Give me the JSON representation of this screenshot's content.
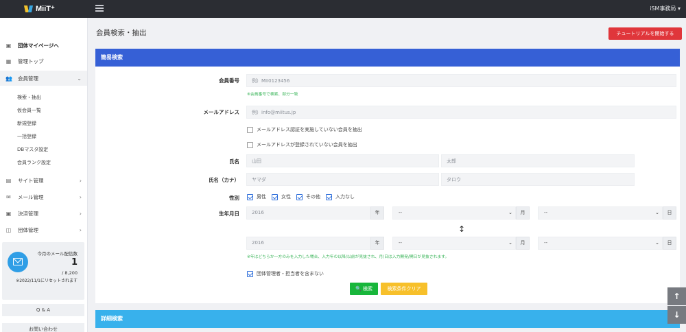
{
  "header": {
    "logo": "MiiT⁺",
    "user": "iSM事務局 ▾"
  },
  "sidebar": {
    "items": [
      {
        "label": "団体マイページへ",
        "icon": "building-icon"
      },
      {
        "label": "管理トップ",
        "icon": "dashboard-icon"
      },
      {
        "label": "会員管理",
        "icon": "users-icon"
      },
      {
        "label": "サイト管理",
        "icon": "site-icon"
      },
      {
        "label": "メール管理",
        "icon": "mail-icon"
      },
      {
        "label": "決済管理",
        "icon": "payment-icon"
      },
      {
        "label": "団体管理",
        "icon": "organization-icon"
      }
    ],
    "submenu": [
      "検索・抽出",
      "仮会員一覧",
      "新規登録",
      "一括登録",
      "DBマスタ設定",
      "会員ランク設定"
    ],
    "mail_card": {
      "title": "今月のメール配信数",
      "count": "1",
      "total": "/ 8,200",
      "reset": "※2022/11/1にリセットされます"
    },
    "qa": "Q & A",
    "contact": "お問い合わせ"
  },
  "page": {
    "title": "会員検索・抽出",
    "tutorial_button": "チュートリアルを開始する"
  },
  "simple_search": {
    "header": "簡易検索",
    "member_number": {
      "label": "会員番号",
      "placeholder": "例）MII0123456",
      "hint": "※会員番号で検索、部分一致"
    },
    "email": {
      "label": "メールアドレス",
      "placeholder": "例）info@miitus.jp"
    },
    "email_checks": [
      "メールアドレス認証を実施していない会員を抽出",
      "メールアドレスが登録されていない会員を抽出"
    ],
    "name": {
      "label": "氏名",
      "last": "山田",
      "first": "太郎"
    },
    "kana": {
      "label": "氏名（カナ）",
      "last": "ヤマダ",
      "first": "タロウ"
    },
    "gender": {
      "label": "性別",
      "options": [
        "男性",
        "女性",
        "その他",
        "入力なし"
      ]
    },
    "birthday": {
      "label": "生年月日",
      "year": "2016",
      "year_unit": "年",
      "month": "--",
      "month_unit": "月",
      "day": "--",
      "day_unit": "日",
      "hint": "※年はどちらか一方のみを入力した場合、入力年の以降/以前が見抜され、月/日は入力開発/開日が見抜されます。"
    },
    "exclude_admin": "団体管理者・担当者を含まない",
    "search_button": "🔍 検索",
    "clear_button": "検索条件クリア"
  },
  "detail_search": {
    "header": "詳細検索"
  },
  "scroll": {
    "up": "↑",
    "down": "↓"
  }
}
